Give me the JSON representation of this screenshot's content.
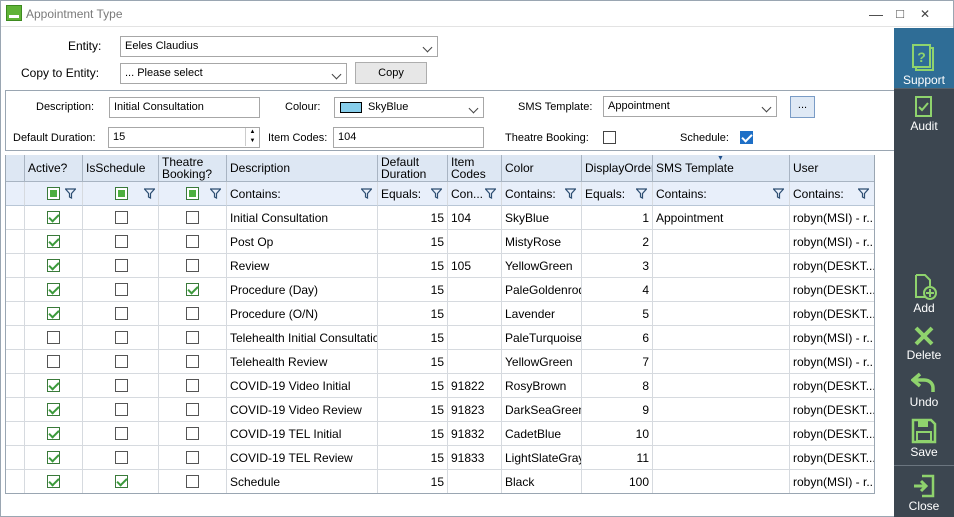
{
  "window": {
    "title": "Appointment Type",
    "minimize": "—",
    "maximize": "□",
    "close": "✕"
  },
  "form": {
    "entity_label": "Entity:",
    "entity_value": "Eeles Claudius",
    "copy_label": "Copy to Entity:",
    "copy_value": "... Please select",
    "copy_button": "Copy"
  },
  "filters": {
    "description_label": "Description:",
    "description_value": "Initial Consultation",
    "colour_label": "Colour:",
    "colour_value": "SkyBlue",
    "colour_swatch": "#87CEEB",
    "sms_label": "SMS Template:",
    "sms_value": "Appointment",
    "sms_button": "...",
    "duration_label": "Default Duration:",
    "duration_value": "15",
    "item_codes_label": "Item Codes:",
    "item_codes_value": "104",
    "theatre_label": "Theatre Booking:",
    "theatre_checked": false,
    "schedule_label": "Schedule:",
    "schedule_checked": true
  },
  "sidebar": {
    "support": "Support",
    "audit": "Audit",
    "add": "Add",
    "delete": "Delete",
    "undo": "Undo",
    "save": "Save",
    "close": "Close"
  },
  "grid": {
    "headers": {
      "active": "Active?",
      "isschedule": "IsSchedule",
      "theatre1": "Theatre",
      "theatre2": "Booking?",
      "description": "Description",
      "duration1": "Default",
      "duration2": "Duration",
      "item1": "Item",
      "item2": "Codes",
      "color": "Color",
      "order": "DisplayOrder",
      "sms": "SMS Template",
      "user": "User"
    },
    "filter_row": {
      "description": "Contains:",
      "duration": "Equals:",
      "item": "Con...",
      "color": "Contains:",
      "order": "Equals:",
      "sms": "Contains:",
      "user": "Contains:"
    },
    "rows": [
      {
        "active": true,
        "schedule": false,
        "theatre": false,
        "description": "Initial Consultation",
        "duration": "15",
        "item": "104",
        "color": "SkyBlue",
        "order": "1",
        "sms": "Appointment",
        "user": "robyn(MSI) - r..."
      },
      {
        "active": true,
        "schedule": false,
        "theatre": false,
        "description": "Post Op",
        "duration": "15",
        "item": "",
        "color": "MistyRose",
        "order": "2",
        "sms": "",
        "user": "robyn(MSI) - r..."
      },
      {
        "active": true,
        "schedule": false,
        "theatre": false,
        "description": "Review",
        "duration": "15",
        "item": "105",
        "color": "YellowGreen",
        "order": "3",
        "sms": "",
        "user": "robyn(DESKT..."
      },
      {
        "active": true,
        "schedule": false,
        "theatre": true,
        "description": "Procedure (Day)",
        "duration": "15",
        "item": "",
        "color": "PaleGoldenrod",
        "order": "4",
        "sms": "",
        "user": "robyn(DESKT..."
      },
      {
        "active": true,
        "schedule": false,
        "theatre": false,
        "description": "Procedure (O/N)",
        "duration": "15",
        "item": "",
        "color": "Lavender",
        "order": "5",
        "sms": "",
        "user": "robyn(DESKT..."
      },
      {
        "active": false,
        "schedule": false,
        "theatre": false,
        "description": "Telehealth Initial Consultation",
        "duration": "15",
        "item": "",
        "color": "PaleTurquoise",
        "order": "6",
        "sms": "",
        "user": "robyn(MSI) - r..."
      },
      {
        "active": false,
        "schedule": false,
        "theatre": false,
        "description": "Telehealth Review",
        "duration": "15",
        "item": "",
        "color": "YellowGreen",
        "order": "7",
        "sms": "",
        "user": "robyn(MSI) - r..."
      },
      {
        "active": true,
        "schedule": false,
        "theatre": false,
        "description": "COVID-19 Video Initial",
        "duration": "15",
        "item": "91822",
        "color": "RosyBrown",
        "order": "8",
        "sms": "",
        "user": "robyn(DESKT..."
      },
      {
        "active": true,
        "schedule": false,
        "theatre": false,
        "description": "COVID-19 Video Review",
        "duration": "15",
        "item": "91823",
        "color": "DarkSeaGreen",
        "order": "9",
        "sms": "",
        "user": "robyn(DESKT..."
      },
      {
        "active": true,
        "schedule": false,
        "theatre": false,
        "description": "COVID-19 TEL Initial",
        "duration": "15",
        "item": "91832",
        "color": "CadetBlue",
        "order": "10",
        "sms": "",
        "user": "robyn(DESKT..."
      },
      {
        "active": true,
        "schedule": false,
        "theatre": false,
        "description": "COVID-19 TEL Review",
        "duration": "15",
        "item": "91833",
        "color": "LightSlateGray",
        "order": "11",
        "sms": "",
        "user": "robyn(DESKT..."
      },
      {
        "active": true,
        "schedule": true,
        "theatre": false,
        "description": "Schedule",
        "duration": "15",
        "item": "",
        "color": "Black",
        "order": "100",
        "sms": "",
        "user": "robyn(MSI) - r..."
      }
    ]
  }
}
